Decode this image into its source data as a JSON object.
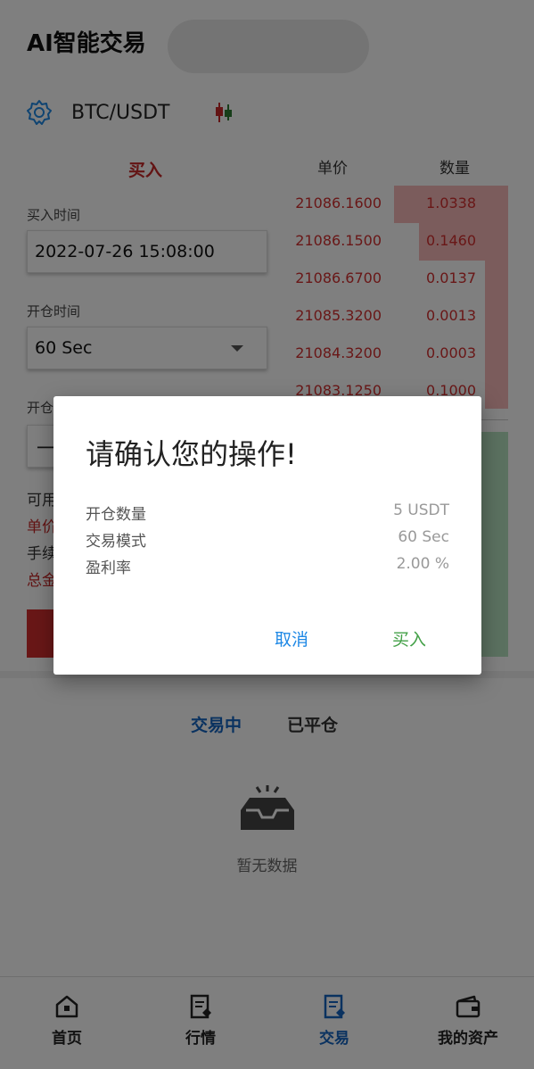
{
  "header": {
    "title": "AI智能交易"
  },
  "pair": {
    "name": "BTC/USDT",
    "settings_icon": "gear-icon",
    "chart_icon": "candlestick-icon"
  },
  "form": {
    "side_title": "买入",
    "buy_time_label": "买入时间",
    "buy_time_value": "2022-07-26 15:08:00",
    "open_time_label": "开仓时间",
    "open_time_value": "60 Sec",
    "open_amount_label_visible": "开仓",
    "amount_stub": "一",
    "info": {
      "available": "可用",
      "unit_price": "单价",
      "fee": "手续",
      "total": "总金"
    }
  },
  "orderbook": {
    "col_price": "单价",
    "col_qty": "数量",
    "rows": [
      {
        "price": "21086.1600",
        "qty": "1.0338"
      },
      {
        "price": "21086.1500",
        "qty": "0.1460"
      },
      {
        "price": "21086.6700",
        "qty": "0.0137"
      },
      {
        "price": "21085.3200",
        "qty": "0.0013"
      },
      {
        "price": "21084.3200",
        "qty": "0.0003"
      },
      {
        "price": "21083.1250",
        "qty": "0.1000"
      }
    ],
    "colors": {
      "ask": "#d32f2f",
      "ask_bar": "#f7b8b8",
      "bid_bar": "#b7e2c1"
    }
  },
  "tabs": {
    "active": "交易中",
    "closed": "已平仓"
  },
  "empty": {
    "icon": "empty-inbox-icon",
    "text": "暂无数据"
  },
  "nav": {
    "home": "首页",
    "market": "行情",
    "trade": "交易",
    "assets": "我的资产"
  },
  "dialog": {
    "title": "请确认您的操作!",
    "rows": [
      {
        "key": "开仓数量",
        "value": "5 USDT"
      },
      {
        "key": "交易模式",
        "value": "60 Sec"
      },
      {
        "key": "盈利率",
        "value": "2.00 %"
      }
    ],
    "cancel": "取消",
    "confirm": "买入"
  }
}
